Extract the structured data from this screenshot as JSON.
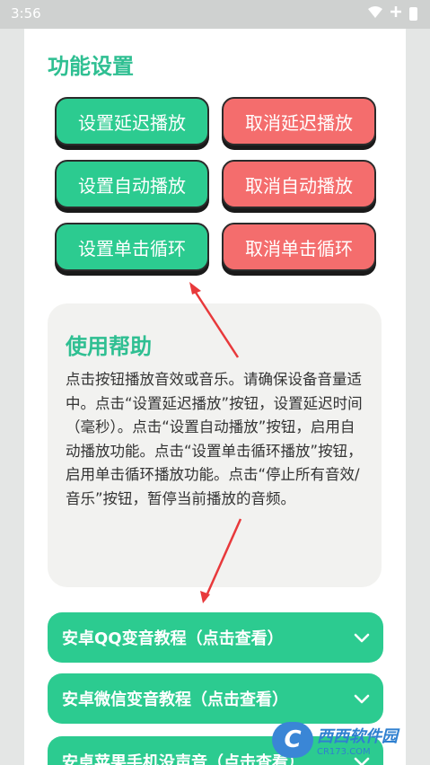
{
  "status_bar": {
    "time": "3:56"
  },
  "settings": {
    "title": "功能设置",
    "buttons": [
      {
        "label": "设置延迟播放"
      },
      {
        "label": "取消延迟播放"
      },
      {
        "label": "设置自动播放"
      },
      {
        "label": "取消自动播放"
      },
      {
        "label": "设置单击循环"
      },
      {
        "label": "取消单击循环"
      }
    ]
  },
  "help": {
    "title": "使用帮助",
    "text": "点击按钮播放音效或音乐。请确保设备音量适中。点击“设置延迟播放”按钮，设置延迟时间（毫秒）。点击“设置自动播放”按钮，启用自动播放功能。点击“设置单击循环播放”按钮，启用单击循环播放功能。点击“停止所有音效/音乐”按钮，暂停当前播放的音频。"
  },
  "tutorials": [
    {
      "label": "安卓QQ变音教程（点击查看）"
    },
    {
      "label": "安卓微信变音教程（点击查看）"
    },
    {
      "label": "安卓苹果手机没声音（点击查看）"
    }
  ],
  "watermark": {
    "logo": "C",
    "name": "西西软件园",
    "url": "CR173.COM"
  },
  "colors": {
    "accent": "#2ccb90",
    "danger": "#f46d6d",
    "title": "#2fbf92",
    "arrow": "#e8393b"
  }
}
